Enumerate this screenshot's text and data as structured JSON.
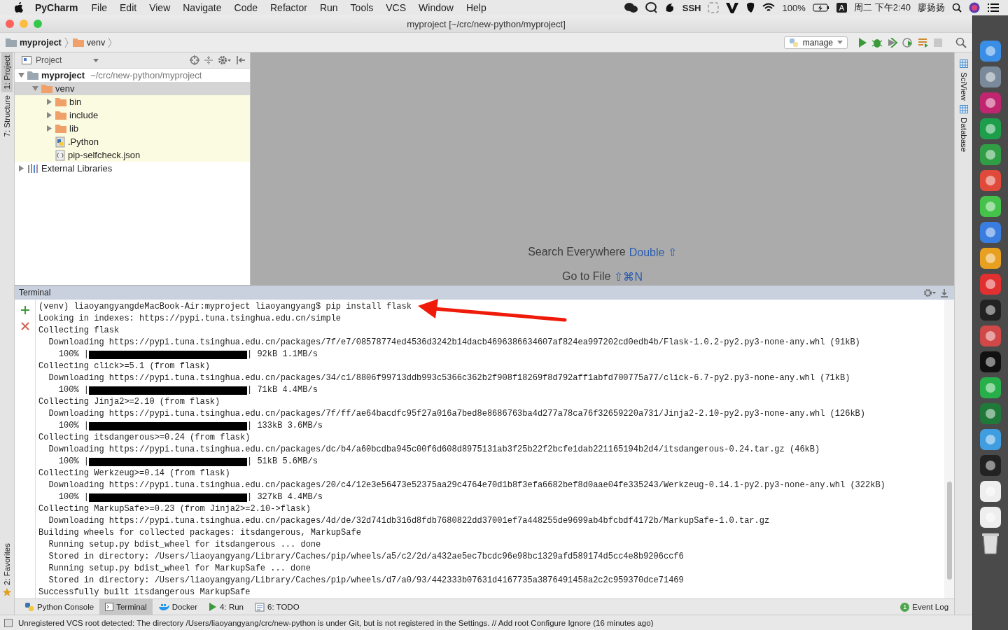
{
  "menubar": {
    "app": "PyCharm",
    "menus": [
      "File",
      "Edit",
      "View",
      "Navigate",
      "Code",
      "Refactor",
      "Run",
      "Tools",
      "VCS",
      "Window",
      "Help"
    ],
    "ssh": "SSH",
    "battery": "100%",
    "input_source": "A",
    "clock": "周二 下午2:40",
    "user": "廖扬扬"
  },
  "window": {
    "title": "myproject [~/crc/new-python/myproject]"
  },
  "breadcrumbs": [
    "myproject",
    "venv"
  ],
  "run_config": "manage",
  "left_tool_tabs": [
    {
      "label": "1: Project",
      "selected": true
    },
    {
      "label": "7: Structure",
      "selected": false
    }
  ],
  "favorites_tab": "2: Favorites",
  "right_tool_tabs": [
    "SciView",
    "Database"
  ],
  "project_panel": {
    "view": "Project",
    "tree": [
      {
        "label": "myproject",
        "path": "~/crc/new-python/myproject",
        "kind": "project-folder",
        "expanded": true,
        "selected": false,
        "children": [
          {
            "label": "venv",
            "kind": "excluded-folder",
            "expanded": true,
            "selected": true,
            "children": [
              {
                "label": "bin",
                "kind": "excluded-folder",
                "expanded": false,
                "selected": false
              },
              {
                "label": "include",
                "kind": "excluded-folder",
                "expanded": false,
                "selected": false
              },
              {
                "label": "lib",
                "kind": "excluded-folder",
                "expanded": false,
                "selected": false
              },
              {
                "label": ".Python",
                "kind": "python-file",
                "selected": false
              },
              {
                "label": "pip-selfcheck.json",
                "kind": "json-file",
                "selected": false
              }
            ]
          }
        ]
      },
      {
        "label": "External Libraries",
        "kind": "libraries",
        "expanded": false,
        "selected": false
      }
    ]
  },
  "editor_hints": [
    {
      "label": "Search Everywhere",
      "shortcut": "Double ⇧"
    },
    {
      "label": "Go to File",
      "shortcut": "⇧⌘N"
    }
  ],
  "terminal": {
    "title": "Terminal",
    "lines": [
      {
        "kind": "text",
        "text": "(venv) liaoyangyangdeMacBook-Air:myproject liaoyangyang$ pip install flask"
      },
      {
        "kind": "text",
        "text": "Looking in indexes: https://pypi.tuna.tsinghua.edu.cn/simple"
      },
      {
        "kind": "text",
        "text": "Collecting flask"
      },
      {
        "kind": "text",
        "text": "  Downloading https://pypi.tuna.tsinghua.edu.cn/packages/7f/e7/08578774ed4536d3242b14dacb4696386634607af824ea997202cd0edb4b/Flask-1.0.2-py2.py3-none-any.whl (91kB)"
      },
      {
        "kind": "progress",
        "percent": "    100% |",
        "level": 1,
        "tail": "| 92kB 1.1MB/s"
      },
      {
        "kind": "text",
        "text": "Collecting click>=5.1 (from flask)"
      },
      {
        "kind": "text",
        "text": "  Downloading https://pypi.tuna.tsinghua.edu.cn/packages/34/c1/8806f99713ddb993c5366c362b2f908f18269f8d792aff1abfd700775a77/click-6.7-py2.py3-none-any.whl (71kB)"
      },
      {
        "kind": "progress",
        "percent": "    100% |",
        "level": 1,
        "tail": "| 71kB 4.4MB/s"
      },
      {
        "kind": "text",
        "text": "Collecting Jinja2>=2.10 (from flask)"
      },
      {
        "kind": "text",
        "text": "  Downloading https://pypi.tuna.tsinghua.edu.cn/packages/7f/ff/ae64bacdfc95f27a016a7bed8e8686763ba4d277a78ca76f32659220a731/Jinja2-2.10-py2.py3-none-any.whl (126kB)"
      },
      {
        "kind": "progress",
        "percent": "    100% |",
        "level": 1,
        "tail": "| 133kB 3.6MB/s"
      },
      {
        "kind": "text",
        "text": "Collecting itsdangerous>=0.24 (from flask)"
      },
      {
        "kind": "text",
        "text": "  Downloading https://pypi.tuna.tsinghua.edu.cn/packages/dc/b4/a60bcdba945c00f6d608d8975131ab3f25b22f2bcfe1dab221165194b2d4/itsdangerous-0.24.tar.gz (46kB)"
      },
      {
        "kind": "progress",
        "percent": "    100% |",
        "level": 1,
        "tail": "| 51kB 5.6MB/s"
      },
      {
        "kind": "text",
        "text": "Collecting Werkzeug>=0.14 (from flask)"
      },
      {
        "kind": "text",
        "text": "  Downloading https://pypi.tuna.tsinghua.edu.cn/packages/20/c4/12e3e56473e52375aa29c4764e70d1b8f3efa6682bef8d0aae04fe335243/Werkzeug-0.14.1-py2.py3-none-any.whl (322kB)"
      },
      {
        "kind": "progress",
        "percent": "    100% |",
        "level": 1,
        "tail": "| 327kB 4.4MB/s"
      },
      {
        "kind": "text",
        "text": "Collecting MarkupSafe>=0.23 (from Jinja2>=2.10->flask)"
      },
      {
        "kind": "text",
        "text": "  Downloading https://pypi.tuna.tsinghua.edu.cn/packages/4d/de/32d741db316d8fdb7680822dd37001ef7a448255de9699ab4bfcbdf4172b/MarkupSafe-1.0.tar.gz"
      },
      {
        "kind": "text",
        "text": "Building wheels for collected packages: itsdangerous, MarkupSafe"
      },
      {
        "kind": "text",
        "text": "  Running setup.py bdist_wheel for itsdangerous ... done"
      },
      {
        "kind": "text",
        "text": "  Stored in directory: /Users/liaoyangyang/Library/Caches/pip/wheels/a5/c2/2d/a432ae5ec7bcdc96e98bc1329afd589174d5cc4e8b9206ccf6"
      },
      {
        "kind": "text",
        "text": "  Running setup.py bdist_wheel for MarkupSafe ... done"
      },
      {
        "kind": "text",
        "text": "  Stored in directory: /Users/liaoyangyang/Library/Caches/pip/wheels/d7/a0/93/442333b07631d4167735a3876491458a2c2c959370dce71469"
      },
      {
        "kind": "text",
        "text": "Successfully built itsdangerous MarkupSafe"
      }
    ]
  },
  "bottom_tabs": [
    {
      "label": "Python Console",
      "kind": "python",
      "selected": false
    },
    {
      "label": "Terminal",
      "kind": "terminal",
      "selected": true
    },
    {
      "label": "Docker",
      "kind": "docker",
      "selected": false
    },
    {
      "label": "4: Run",
      "kind": "run",
      "selected": false
    },
    {
      "label": "6: TODO",
      "kind": "todo",
      "selected": false
    }
  ],
  "event_log": {
    "label": "Event Log",
    "count": "1"
  },
  "status_bar": "Unregistered VCS root detected: The directory /Users/liaoyangyang/crc/new-python is under Git, but is not registered in the Settings. // Add root  Configure  Ignore (16 minutes ago)"
}
